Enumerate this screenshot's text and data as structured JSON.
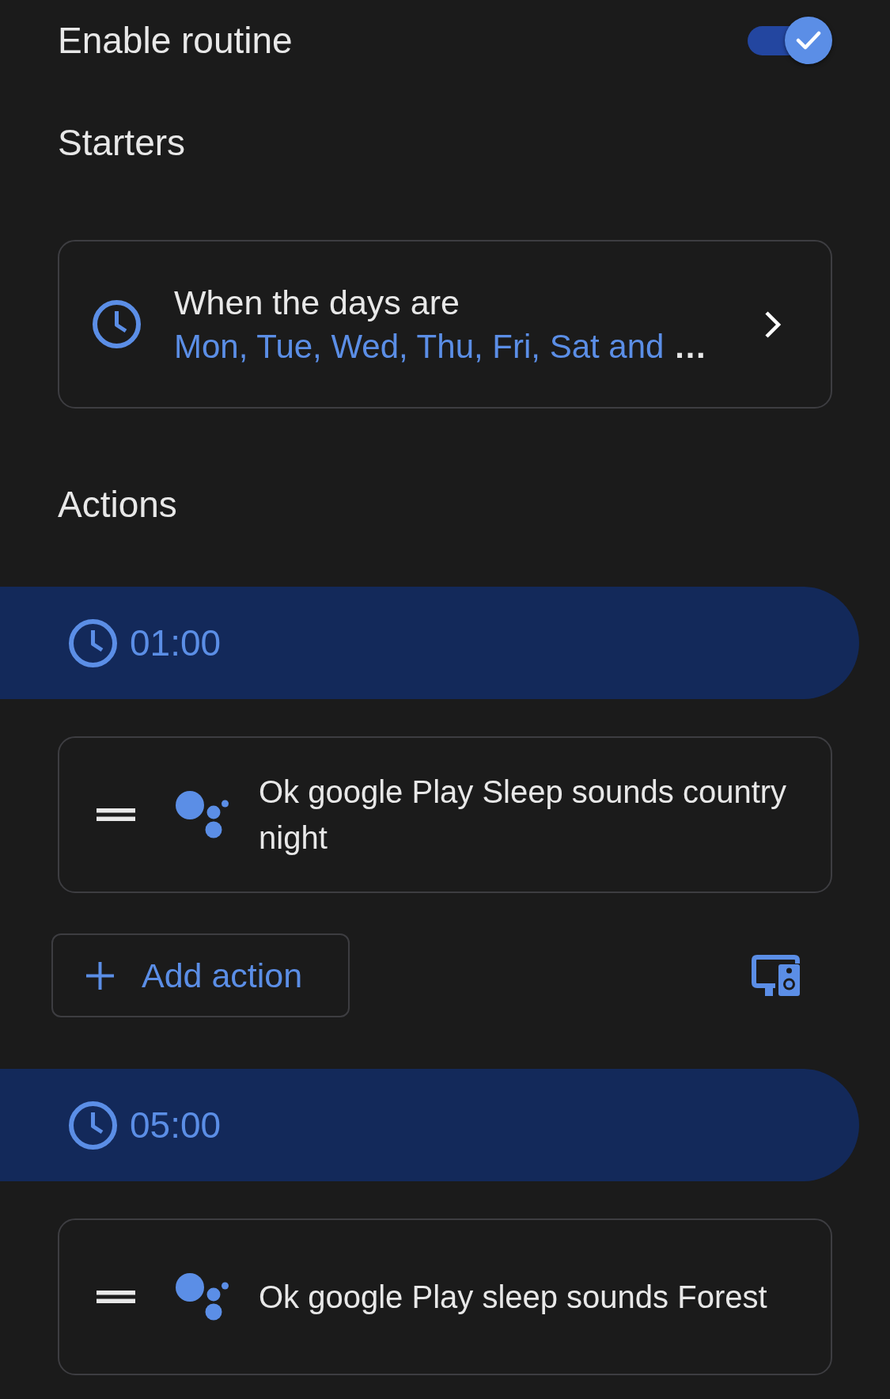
{
  "enable_routine": {
    "label": "Enable routine",
    "on": true
  },
  "starters": {
    "title": "Starters",
    "items": [
      {
        "title": "When the days are",
        "summary": "Mon, Tue, Wed, Thu, Fri, Sat and",
        "more": "…"
      }
    ]
  },
  "actions": {
    "title": "Actions",
    "groups": [
      {
        "time": "01:00",
        "items": [
          {
            "text": "Ok google Play Sleep sounds country night"
          }
        ],
        "add_action": {
          "label": "Add action"
        }
      },
      {
        "time": "05:00",
        "items": [
          {
            "text": "Ok google Play sleep sounds Forest"
          }
        ]
      }
    ]
  }
}
